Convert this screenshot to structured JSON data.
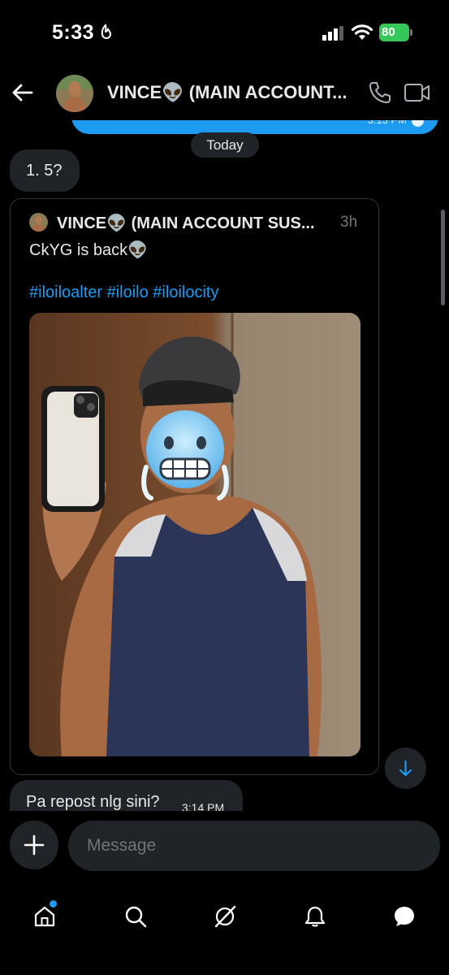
{
  "status_bar": {
    "time": "5:33",
    "battery": "80"
  },
  "header": {
    "contact_name": "VINCE👽 (MAIN ACCOUNT..."
  },
  "previous_message": {
    "time": "3:13 PM"
  },
  "date_divider": "Today",
  "messages": [
    {
      "text": "1. 5?"
    },
    {
      "text": "Pa repost nlg sini?",
      "time": "3:14 PM"
    }
  ],
  "shared_post": {
    "author": "VINCE👽 (MAIN ACCOUNT SUS...",
    "time": "3h",
    "text": "CkYG  is back👽",
    "hashtags": "#iloiloalter #iloilo #iloilocity"
  },
  "composer": {
    "placeholder": "Message"
  },
  "tabs": [
    {
      "name": "home"
    },
    {
      "name": "search"
    },
    {
      "name": "grok"
    },
    {
      "name": "notifications"
    },
    {
      "name": "messages"
    }
  ],
  "colors": {
    "accent": "#1d9bf0",
    "bubble": "#202327",
    "background": "#000000",
    "battery": "#35c759"
  }
}
